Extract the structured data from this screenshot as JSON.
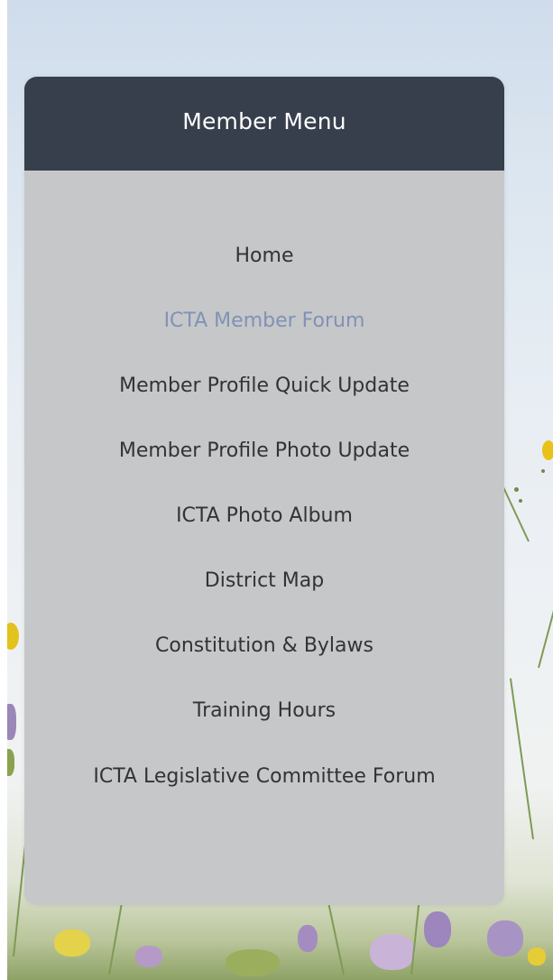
{
  "menu": {
    "title": "Member Menu",
    "items": [
      {
        "label": "Home",
        "active": false
      },
      {
        "label": "ICTA Member Forum",
        "active": true
      },
      {
        "label": "Member Profile Quick Update",
        "active": false
      },
      {
        "label": "Member Profile Photo Update",
        "active": false
      },
      {
        "label": "ICTA Photo Album",
        "active": false
      },
      {
        "label": "District Map",
        "active": false
      },
      {
        "label": "Constitution & Bylaws",
        "active": false
      },
      {
        "label": "Training Hours",
        "active": false
      },
      {
        "label": "ICTA Legislative Committee Forum",
        "active": false
      }
    ]
  },
  "colors": {
    "header_bg": "#373e4c",
    "panel_bg": "#c6c7c9",
    "link_text": "#333333",
    "active_link": "#8092b6"
  }
}
